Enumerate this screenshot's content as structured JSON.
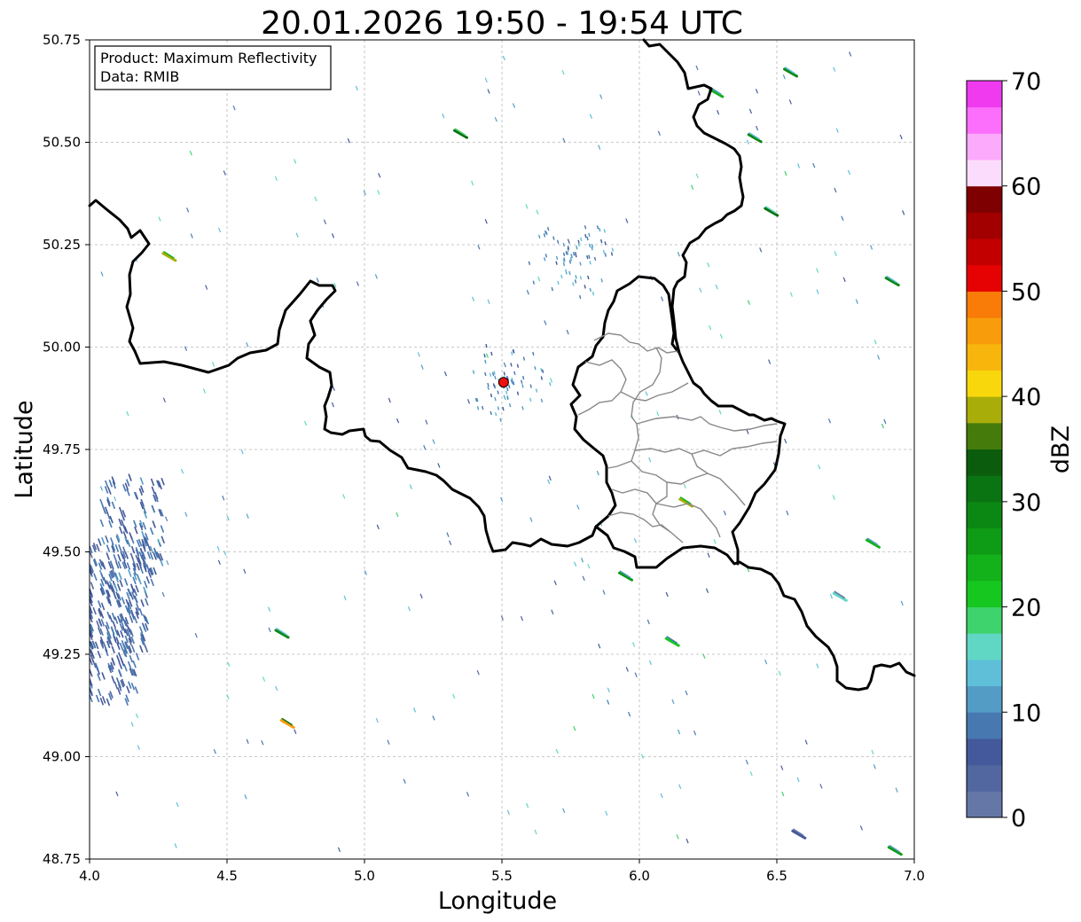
{
  "title": "20.01.2026 19:50 - 19:54 UTC",
  "info_box": {
    "product_line": "Product: Maximum Reflectivity",
    "data_line": "Data: RMIB"
  },
  "axes": {
    "xlabel": "Longitude",
    "ylabel": "Latitude",
    "xlim": [
      4.0,
      7.0
    ],
    "ylim": [
      48.75,
      50.75
    ],
    "xticks": [
      "4.0",
      "4.5",
      "5.0",
      "5.5",
      "6.0",
      "6.5",
      "7.0"
    ],
    "yticks": [
      "48.75",
      "49.00",
      "49.25",
      "49.50",
      "49.75",
      "50.00",
      "50.25",
      "50.50",
      "50.75"
    ],
    "grid": true
  },
  "colorbar": {
    "label": "dBZ",
    "min": 0,
    "max": 70,
    "ticks": [
      "0",
      "10",
      "20",
      "30",
      "40",
      "50",
      "60",
      "70"
    ],
    "colors": [
      "#6577a6",
      "#52669f",
      "#43599b",
      "#4878b0",
      "#529cc5",
      "#5fbfd9",
      "#60d7c4",
      "#3ed36c",
      "#16c71f",
      "#13b11a",
      "#0e9b15",
      "#0b8814",
      "#0a7312",
      "#0b5d0d",
      "#457b0a",
      "#a9ad0a",
      "#f8d80c",
      "#f8b60c",
      "#f89c0c",
      "#f97b08",
      "#e60203",
      "#c30000",
      "#a20000",
      "#7e0000",
      "#fcdcfc",
      "#fcaafc",
      "#fc6efc",
      "#f03af0"
    ]
  },
  "radar_site": {
    "lon": 5.506,
    "lat": 49.914,
    "color": "#ee1111"
  },
  "chart_data": {
    "type": "map",
    "title": "20.01.2026 19:50 - 19:54 UTC",
    "xlabel": "Longitude",
    "ylabel": "Latitude",
    "xlim": [
      4.0,
      7.0
    ],
    "ylim": [
      48.75,
      50.75
    ],
    "grid": true,
    "colorbar_label": "dBZ",
    "colorbar_range": [
      0,
      70
    ],
    "radar_site": {
      "lon": 5.506,
      "lat": 49.914
    },
    "echoes": [
      {
        "lon": 4.1,
        "lat": 49.4,
        "dbz": 4,
        "kind": "cluster"
      },
      {
        "lon": 4.15,
        "lat": 49.55,
        "dbz": 5,
        "kind": "cluster"
      },
      {
        "lon": 4.06,
        "lat": 49.28,
        "dbz": 4,
        "kind": "cluster"
      },
      {
        "lon": 6.48,
        "lat": 50.33,
        "dbz": 30,
        "kind": "cell"
      },
      {
        "lon": 6.42,
        "lat": 50.51,
        "dbz": 28,
        "kind": "cell"
      },
      {
        "lon": 6.28,
        "lat": 50.62,
        "dbz": 24,
        "kind": "cell"
      },
      {
        "lon": 6.92,
        "lat": 50.16,
        "dbz": 28,
        "kind": "cell"
      },
      {
        "lon": 6.85,
        "lat": 49.52,
        "dbz": 24,
        "kind": "cell"
      },
      {
        "lon": 6.73,
        "lat": 49.39,
        "dbz": 16,
        "kind": "cell"
      },
      {
        "lon": 4.72,
        "lat": 49.08,
        "dbz": 45,
        "kind": "cell"
      },
      {
        "lon": 6.17,
        "lat": 49.62,
        "dbz": 38,
        "kind": "cell"
      },
      {
        "lon": 5.95,
        "lat": 49.44,
        "dbz": 26,
        "kind": "cell"
      },
      {
        "lon": 6.12,
        "lat": 49.28,
        "dbz": 22,
        "kind": "cell"
      },
      {
        "lon": 4.7,
        "lat": 49.3,
        "dbz": 28,
        "kind": "cell"
      },
      {
        "lon": 4.29,
        "lat": 50.22,
        "dbz": 38,
        "kind": "cell"
      },
      {
        "lon": 5.35,
        "lat": 50.52,
        "dbz": 32,
        "kind": "cell"
      },
      {
        "lon": 6.55,
        "lat": 50.67,
        "dbz": 28,
        "kind": "cell"
      },
      {
        "lon": 5.5,
        "lat": 49.92,
        "dbz": 6,
        "kind": "clutter"
      },
      {
        "lon": 5.75,
        "lat": 50.22,
        "dbz": 6,
        "kind": "clutter"
      },
      {
        "lon": 6.58,
        "lat": 48.81,
        "dbz": 5,
        "kind": "cell"
      },
      {
        "lon": 6.93,
        "lat": 48.77,
        "dbz": 26,
        "kind": "cell"
      }
    ]
  }
}
